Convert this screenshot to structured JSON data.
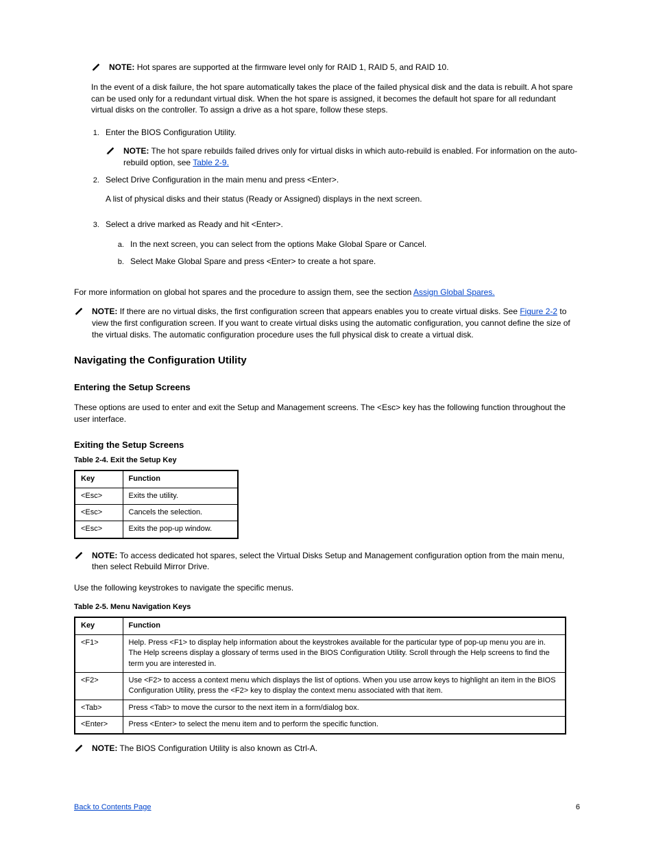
{
  "notes": {
    "note1_label": "NOTE:",
    "note1_body": "Hot spares are supported at the firmware level only for RAID 1, RAID 5, and RAID 10.",
    "note2_label": "NOTE:",
    "note2_body": "The hot spare rebuilds failed drives only for virtual disks in which auto-rebuild is enabled. For information on the auto-rebuild option, see",
    "note2_link": "Table 2-9.",
    "note3_label": "NOTE:",
    "note3_body": "If there are no virtual disks, the first configuration screen that appears enables you to create virtual disks. See",
    "note3_link": "Figure 2-2",
    "note3_after": "to view the first configuration screen. If you want to create virtual disks using the automatic configuration, you cannot define the size of the virtual disks. The automatic configuration procedure uses the full physical disk to create a virtual disk.",
    "note4_label": "NOTE:",
    "note4_body": "To access dedicated hot spares, select the Virtual Disks Setup and Management configuration option from the main menu, then select Rebuild Mirror Drive.",
    "note5_label": "NOTE:",
    "note5_body": "The BIOS Configuration Utility is also known as Ctrl-A."
  },
  "para": {
    "p1": "In the event of a disk failure, the hot spare automatically takes the place of the failed physical disk and the data is rebuilt. A hot spare can be used only for a redundant virtual disk. When the hot spare is assigned, it becomes the default hot spare for all redundant virtual disks on the controller. To assign a drive as a hot spare, follow these steps.",
    "p2": "For more information on global hot spares and the procedure to assign them, see the section",
    "p2_link": "Assign Global Spares.",
    "p3": "These options are used to enter and exit the Setup and Management screens. The <Esc> key has the following function throughout the user interface.",
    "p4": "Use the following keystrokes to navigate the specific menus."
  },
  "lists": {
    "step1": "Enter the BIOS Configuration Utility.",
    "step2": "Select Drive Configuration in the main menu and press <Enter>.",
    "step2_detail": "A list of physical disks and their status (Ready or Assigned) displays in the next screen.",
    "step3": "Select a drive marked as Ready and hit <Enter>.",
    "step3_sub1": "In the next screen, you can select from the options Make Global Spare or Cancel.",
    "step3_sub2": "Select Make Global Spare and press <Enter> to create a hot spare."
  },
  "headings": {
    "nav": "Navigating the Configuration Utility",
    "ent_set": "Entering the Setup Screens",
    "ext_set": "Exiting the Setup Screens"
  },
  "tables": {
    "t1_caption": "Table 2-4. Exit the Setup Key",
    "t1_h1": "Key",
    "t1_h2": "Function",
    "t1_r1c1": "<Esc>",
    "t1_r1c2": "Exits the utility.",
    "t1_r2c1": "<Esc>",
    "t1_r2c2": "Cancels the selection.",
    "t1_r3c1": "<Esc>",
    "t1_r3c2": "Exits the pop-up window.",
    "t2_caption": "Table 2-5. Menu Navigation Keys",
    "t2_h1": "Key",
    "t2_h2": "Function",
    "t2_r1c1": "<F1>",
    "t2_r1c2": "Help. Press <F1> to display help information about the keystrokes available for the particular type of pop-up menu you are in. The Help screens display a glossary of terms used in the BIOS Configuration Utility. Scroll through the Help screens to find the term you are interested in.",
    "t2_r2c1": "<F2>",
    "t2_r2c2": "Use <F2> to access a context menu which displays the list of options. When you use arrow keys to highlight an item in the BIOS Configuration Utility, press the <F2> key to display the context menu associated with that item.",
    "t2_r3c1": "<Tab>",
    "t2_r3c2": "Press <Tab> to move the cursor to the next item in a form/dialog box.",
    "t2_r4c1": "<Enter>",
    "t2_r4c2": "Press <Enter> to select the menu item and to perform the specific function."
  },
  "footer": {
    "back": "Back to Contents Page",
    "page": "6"
  }
}
